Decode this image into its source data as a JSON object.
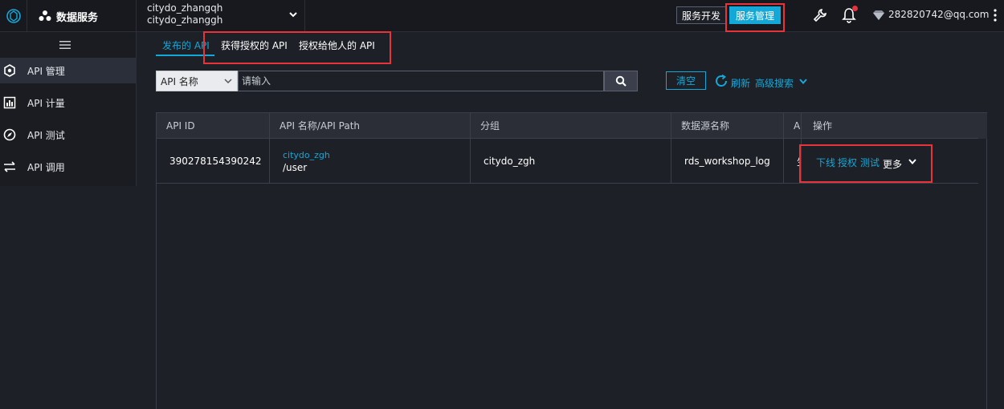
{
  "colors": {
    "accent": "#14a8d8",
    "highlight_box": "#e8333a",
    "background": "#1d2027",
    "topbar": "#17191f"
  },
  "topbar": {
    "logo_icon": "aliyun-dataworks-logo-icon",
    "brand_icon": "data-service-icon",
    "brand_label": "数据服务",
    "project_line1": "citydo_zhangqh",
    "project_line2": "citydo_zhanggh",
    "project_chevron_icon": "chevron-down-icon",
    "dev_button": "服务开发",
    "mgmt_button": "服务管理",
    "tool_icon": "wrench-icon",
    "bell_icon": "bell-icon",
    "gem_icon": "gem-icon",
    "account": "282820742@qq.com",
    "more_icon": "vertical-dots-icon"
  },
  "sidebar": {
    "toggle_icon": "hamburger-icon",
    "items": [
      {
        "label": "API 管理",
        "icon": "hexagon-icon"
      },
      {
        "label": "API 计量",
        "icon": "bar-chart-icon"
      },
      {
        "label": "API 测试",
        "icon": "compass-icon"
      },
      {
        "label": "API 调用",
        "icon": "swap-arrows-icon"
      }
    ]
  },
  "tabs": [
    {
      "label": "发布的 API"
    },
    {
      "label": "获得授权的 API"
    },
    {
      "label": "授权给他人的 API"
    }
  ],
  "search": {
    "type_selected": "API 名称",
    "placeholder": "请输入",
    "search_icon": "search-icon"
  },
  "toolbar": {
    "clear": "清空",
    "refresh_icon": "refresh-icon",
    "refresh": "刷新",
    "advanced_search": "高级搜索"
  },
  "table": {
    "columns": [
      "API ID",
      "API 名称/API Path",
      "分组",
      "数据源名称",
      "AI",
      "操作"
    ],
    "rows": [
      {
        "api_id": "390278154390242",
        "api_name": "citydo_zgh",
        "api_path": "/user",
        "group": "citydo_zgh",
        "datasource": "rds_workshop_log",
        "hidden_col": "生",
        "actions": [
          "下线",
          "授权",
          "测试"
        ],
        "more": "更多"
      }
    ]
  }
}
